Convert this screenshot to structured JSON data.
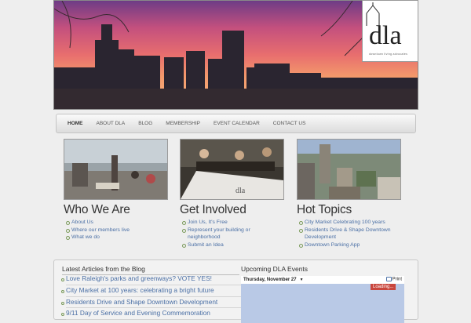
{
  "logo": {
    "text": "dla",
    "tagline": "downtown living advocates"
  },
  "nav": {
    "items": [
      "Home",
      "About DLA",
      "Blog",
      "Membership",
      "Event Calendar",
      "Contact Us"
    ],
    "active": "Home"
  },
  "columns": [
    {
      "heading": "Who We Are",
      "links": [
        "About Us",
        "Where our members live",
        "What we do"
      ]
    },
    {
      "heading": "Get Involved",
      "links": [
        "Join Us, It's Free",
        "Represent your building or neighborhood",
        "Submit an Idea"
      ]
    },
    {
      "heading": "Hot Topics",
      "links": [
        "City Market Celebrating 100 years",
        "Residents Drive & Shape Downtown Development",
        "Downtown Parking App"
      ]
    }
  ],
  "blog": {
    "title": "Latest Articles from the Blog",
    "items": [
      "Love Raleigh's parks and greenways? VOTE YES!",
      "City Market at 100 years: celebrating a bright future",
      "Residents Drive and Shape Downtown Development",
      "9/11 Day of Service and Evening Commemoration"
    ]
  },
  "events": {
    "title": "Upcoming DLA Events",
    "date": "Thursday, November 27",
    "print": "Print",
    "loading": "Loading..."
  }
}
